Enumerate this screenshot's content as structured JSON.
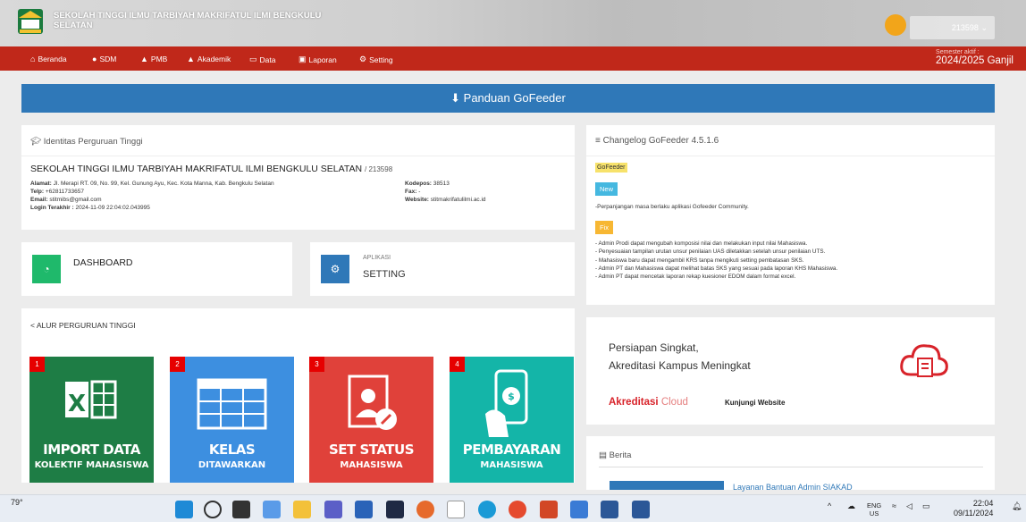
{
  "header": {
    "title": "SEKOLAH TINGGI ILMU TARBIYAH MAKRIFATUL ILMI BENGKULU SELATAN",
    "user_code": "213598"
  },
  "nav": {
    "items": [
      {
        "label": "Beranda",
        "icon": "home-icon"
      },
      {
        "label": "SDM",
        "icon": "user-icon"
      },
      {
        "label": "PMB",
        "icon": "graduation-cap-icon"
      },
      {
        "label": "Akademik",
        "icon": "graduation-cap-icon"
      },
      {
        "label": "Data",
        "icon": "folder-icon"
      },
      {
        "label": "Laporan",
        "icon": "print-icon"
      },
      {
        "label": "Setting",
        "icon": "gear-icon"
      }
    ],
    "semester_label": "Semester aktif :",
    "semester_value": "2024/2025 Ganjil"
  },
  "panduan": {
    "label": "Panduan GoFeeder"
  },
  "identitas": {
    "heading": "Identitas Perguruan Tinggi",
    "name": "SEKOLAH TINGGI ILMU TARBIYAH MAKRIFATUL ILMI BENGKULU SELATAN",
    "code": "/ 213598",
    "alamat_label": "Alamat:",
    "alamat": "Jl. Merapi RT. 09, No. 99, Kel. Gunung Ayu, Kec. Kota Manna, Kab. Bengkulu Selatan",
    "telp_label": "Telp:",
    "telp": "+62811733657",
    "email_label": "Email:",
    "email": "stitmibs@gmail.com",
    "login_label": "Login Terakhir :",
    "login": "2024-11-09 22:04:02.043995",
    "kodepos_label": "Kodepos:",
    "kodepos": "38513",
    "fax_label": "Fax:",
    "fax": "-",
    "website_label": "Website:",
    "website": "stitmakrifatulilmi.ac.id"
  },
  "dashboard": {
    "label": "DASHBOARD"
  },
  "setting": {
    "sub": "APLIKASI",
    "label": "SETTING"
  },
  "alur": {
    "heading": "ALUR PERGURUAN TINGGI",
    "tiles": [
      {
        "num": "1",
        "big": "IMPORT DATA",
        "small": "KOLEKTIF MAHASISWA",
        "color": "#1e7d45"
      },
      {
        "num": "2",
        "big": "KELAS",
        "small": "DITAWARKAN",
        "color": "#3d8fe0"
      },
      {
        "num": "3",
        "big": "SET STATUS",
        "small": "MAHASISWA",
        "color": "#e0413a"
      },
      {
        "num": "4",
        "big": "PEMBAYARAN",
        "small": "MAHASISWA",
        "color": "#14b5a8"
      }
    ]
  },
  "changelog": {
    "heading": "Changelog GoFeeder 4.5.1.6",
    "tag": "GoFeeder",
    "new_label": "New",
    "new_text": "-Perpanjangan masa berlaku aplikasi Gofeeder Community.",
    "fix_label": "Fix",
    "fix_items": [
      "- Admin Prodi dapat mengubah komposisi nilai dan melakukan input nilai Mahasiswa.",
      "- Penyesuaian tampilan urutan unsur penilaian UAS diletakkan setelah unsur penilaian UTS.",
      "- Mahasiswa baru dapat mengambil KRS tanpa mengikuti setting pembatasan SKS.",
      "- Admin PT dan Mahasiswa dapat melihat batas SKS yang sesuai pada laporan KHS Mahasiswa.",
      "- Admin PT dapat mencetak laporan rekap kuesioner EDOM dalam format excel."
    ]
  },
  "akreditasi": {
    "line1": "Persiapan Singkat,",
    "line2": "Akreditasi Kampus Meningkat",
    "brand": "Akreditasi",
    "brand_cloud": "Cloud",
    "visit": "Kunjungi Website"
  },
  "berita": {
    "heading": "Berita",
    "link": "Layanan Bantuan Admin SIAKAD"
  },
  "taskbar": {
    "temp": "79°",
    "lang1": "ENG",
    "lang2": "US",
    "time": "22:04",
    "date": "09/11/2024"
  }
}
